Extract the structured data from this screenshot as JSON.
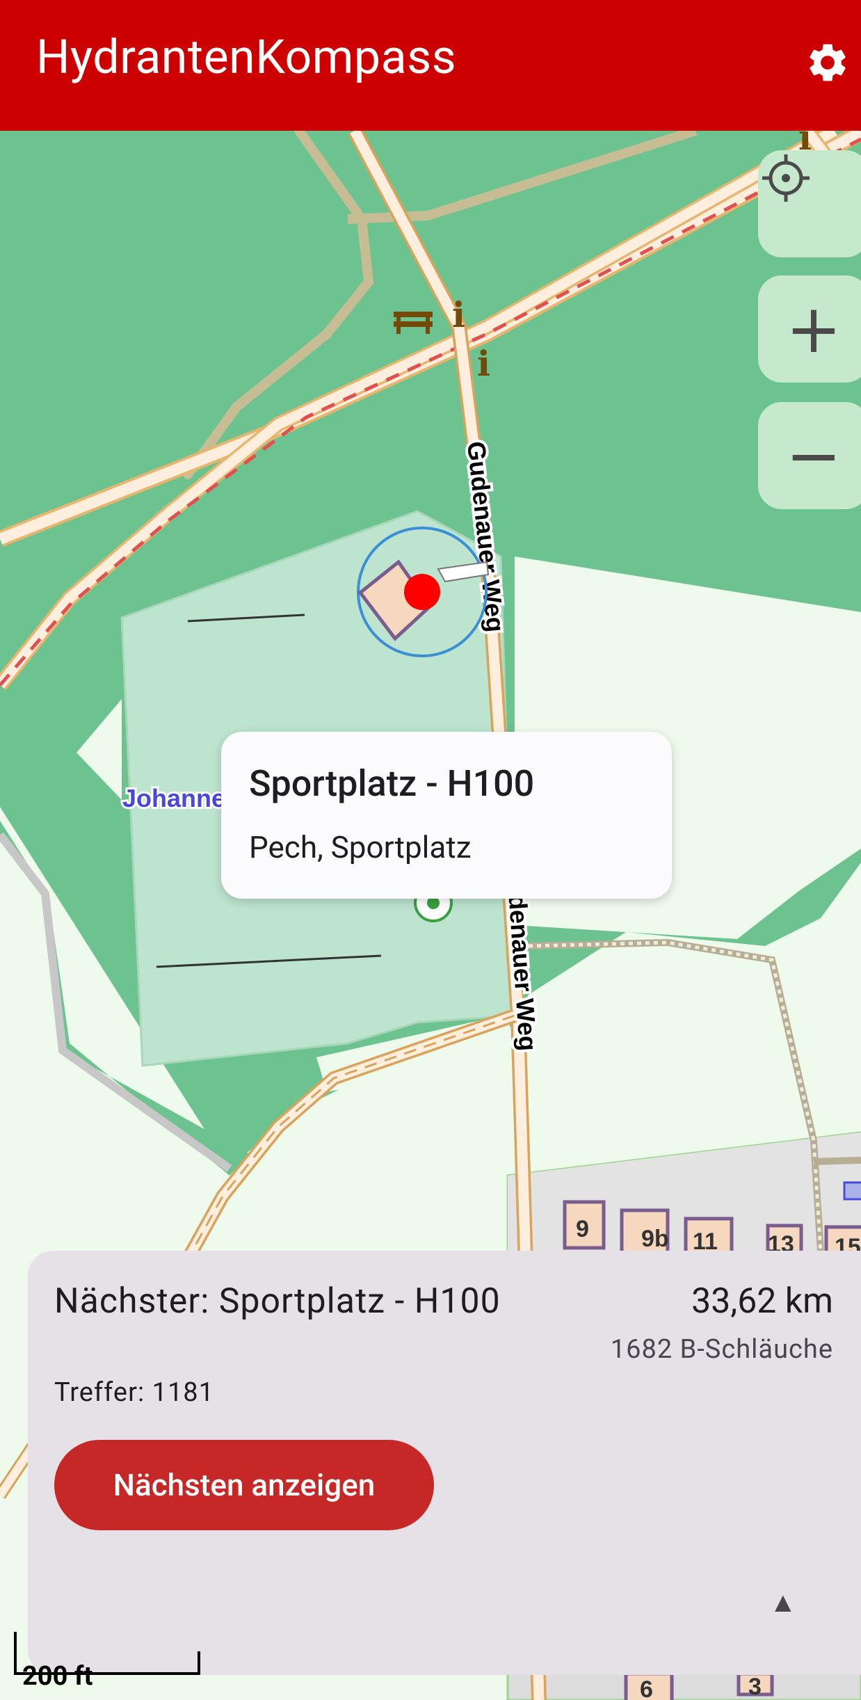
{
  "app": {
    "title": "HydrantenKompass",
    "settings_icon": "gear-icon",
    "colors": {
      "appbar": "#cc0000",
      "primary_button": "#c62828",
      "hydrant_marker": "#ff0000",
      "location_ring": "#3a8fd6"
    }
  },
  "map": {
    "controls": {
      "locate_icon": "crosshair-icon",
      "zoom_in_label": "+",
      "zoom_out_label": "−"
    },
    "labels": {
      "road_1": "Gudenauer Weg",
      "road_2": "Gudenauer Weg",
      "area_name": "Johannes-Brahms-Sportanlage",
      "house_numbers": [
        "9",
        "9b",
        "11",
        "13",
        "15",
        "6",
        "3"
      ]
    },
    "scale": {
      "label": "200 ft"
    }
  },
  "popup": {
    "title": "Sportplatz - H100",
    "subtitle": "Pech, Sportplatz"
  },
  "sheet": {
    "next_label": "Nächster: Sportplatz - H100",
    "distance": "33,62 km",
    "hoses": "1682 B-Schläuche",
    "hits": "Treffer: 1181",
    "show_button": "Nächsten anzeigen",
    "expand_icon": "▲"
  }
}
